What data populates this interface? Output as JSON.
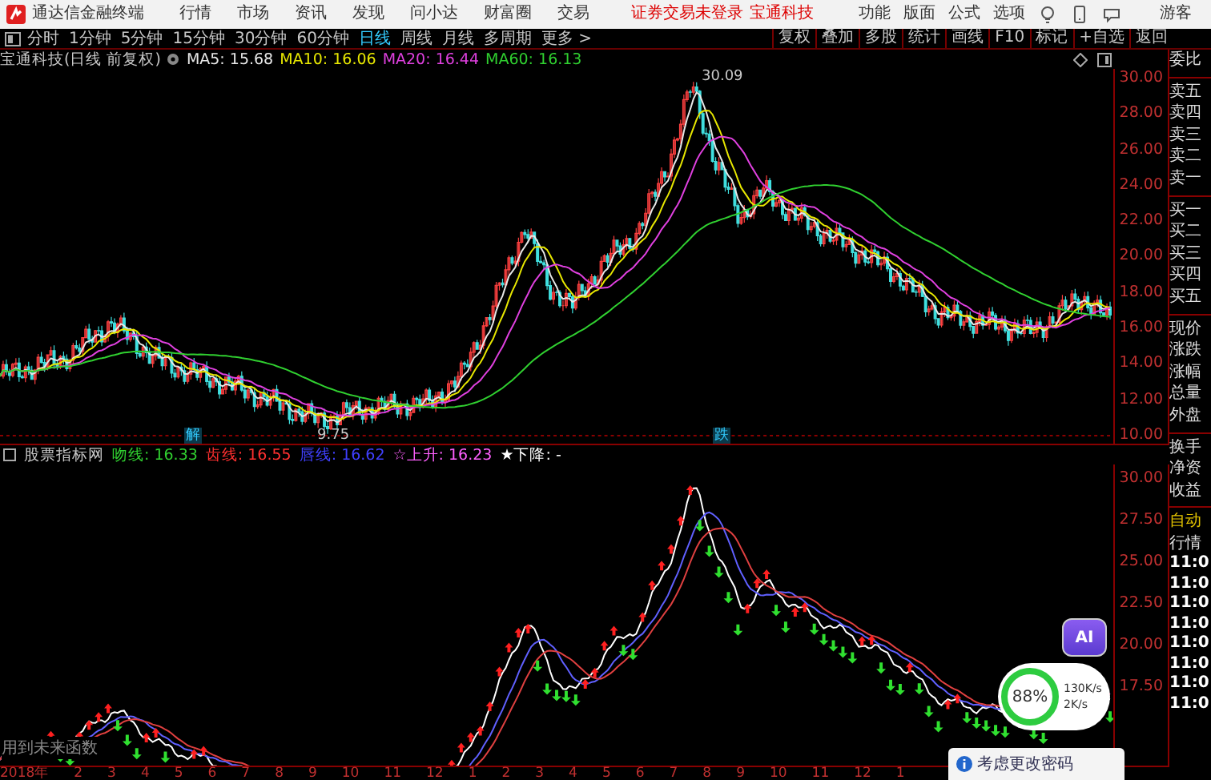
{
  "title_bar": {
    "app_name": "通达信金融终端",
    "menu": [
      "行情",
      "市场",
      "资讯",
      "发现",
      "问小达",
      "财富圈",
      "交易"
    ],
    "login_status": "证券交易未登录",
    "stock_name": "宝通科技",
    "right_menu": [
      "功能",
      "版面",
      "公式",
      "选项"
    ],
    "user": "游客"
  },
  "period_tabs": [
    {
      "label": "分时",
      "selected": false
    },
    {
      "label": "1分钟",
      "selected": false
    },
    {
      "label": "5分钟",
      "selected": false
    },
    {
      "label": "15分钟",
      "selected": false
    },
    {
      "label": "30分钟",
      "selected": false
    },
    {
      "label": "60分钟",
      "selected": false
    },
    {
      "label": "日线",
      "selected": true
    },
    {
      "label": "周线",
      "selected": false
    },
    {
      "label": "月线",
      "selected": false
    },
    {
      "label": "多周期",
      "selected": false
    },
    {
      "label": "更多 >",
      "selected": false
    }
  ],
  "toolbar_buttons": [
    "复权",
    "叠加",
    "多股",
    "统计",
    "画线",
    "F10",
    "标记",
    "+自选",
    "返回"
  ],
  "main_chart": {
    "title": "宝通科技(日线 前复权)",
    "indicators": [
      {
        "label": "MA5: 15.68",
        "color": "#e8e8e8"
      },
      {
        "label": "MA10: 16.06",
        "color": "#e8e800"
      },
      {
        "label": "MA20: 16.44",
        "color": "#e040e0"
      },
      {
        "label": "MA60: 16.13",
        "color": "#30d030"
      }
    ],
    "high_label": "30.09",
    "low_label": "9.75",
    "markers": [
      "解",
      "跌"
    ],
    "axis_labels": [
      "30.00",
      "28.00",
      "26.00",
      "24.00",
      "22.00",
      "20.00",
      "18.00",
      "16.00",
      "14.00",
      "12.00",
      "10.00"
    ]
  },
  "indicator_chart": {
    "title": "股票指标网",
    "lines": [
      {
        "label": "吻线: 16.33",
        "color": "#30d030"
      },
      {
        "label": "齿线: 16.55",
        "color": "#ff3030"
      },
      {
        "label": "唇线: 16.62",
        "color": "#4040ff"
      },
      {
        "label": "☆上升: 16.23",
        "color": "#ff60ff"
      },
      {
        "label": "★下降: -",
        "color": "#ffffff"
      }
    ],
    "note": "用到未来函数",
    "axis_labels": [
      "30.00",
      "27.50",
      "25.00",
      "22.50",
      "20.00",
      "17.50"
    ]
  },
  "date_axis": [
    "2018年",
    "2",
    "3",
    "4",
    "5",
    "6",
    "7",
    "8",
    "9",
    "10",
    "11",
    "12",
    "1",
    "2",
    "3",
    "4",
    "5",
    "6",
    "7",
    "8",
    "9",
    "10",
    "11",
    "12",
    "1"
  ],
  "quote_panel": {
    "labels": [
      "委比",
      "卖五",
      "卖四",
      "卖三",
      "卖二",
      "卖一",
      "买一",
      "买二",
      "买三",
      "买四",
      "买五",
      "现价",
      "涨跌",
      "涨幅",
      "总量",
      "外盘",
      "换手",
      "净资",
      "收益"
    ],
    "tick_title": "自动",
    "tick_subtitle": "行情",
    "times": [
      "11:0",
      "11:0",
      "11:0",
      "11:0",
      "11:0",
      "11:0",
      "11:0",
      "11:0"
    ]
  },
  "speed_widget": {
    "percent": "88%",
    "upload": "130K/s",
    "download": "2K/s",
    "ai_label": "AI"
  },
  "notice": {
    "text": "考虑更改密码"
  }
}
